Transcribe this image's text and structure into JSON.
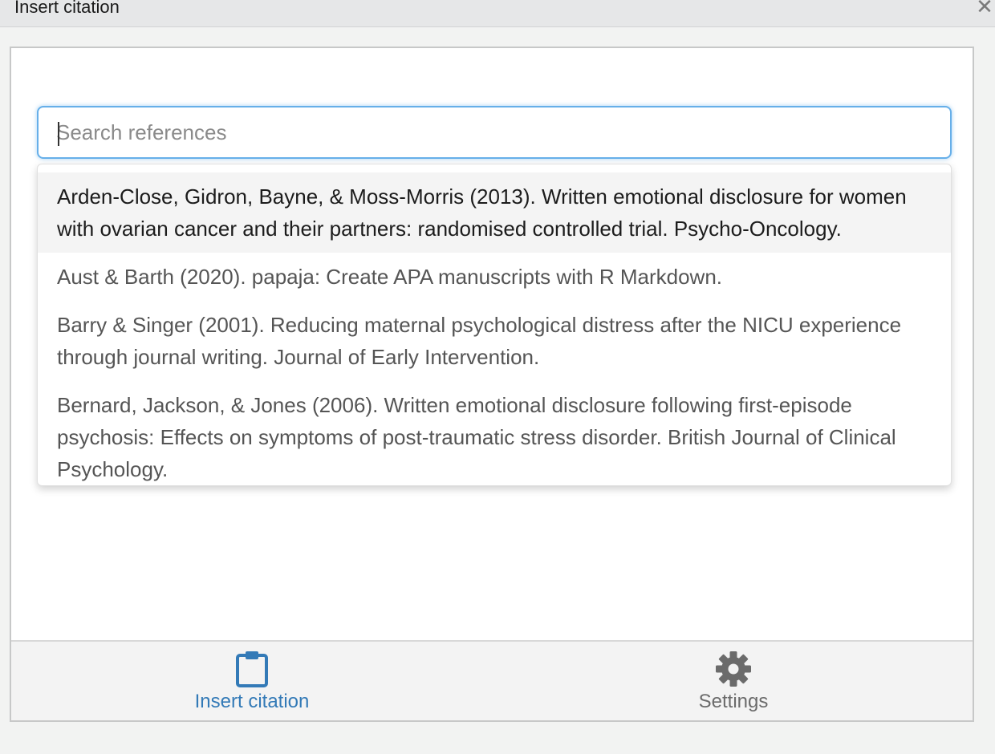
{
  "window": {
    "title": "Insert citation",
    "close_symbol": "✕"
  },
  "search": {
    "placeholder": "Search references",
    "value": ""
  },
  "references": [
    {
      "text": "Arden-Close, Gidron, Bayne, & Moss-Morris (2013). Written emotional disclosure for women with ovarian cancer and their partners: randomised controlled trial. Psycho-Oncology.",
      "highlighted": true
    },
    {
      "text": "Aust & Barth (2020). papaja: Create APA manuscripts with R Markdown.",
      "highlighted": false
    },
    {
      "text": "Barry & Singer (2001). Reducing maternal psychological distress after the NICU experience through journal writing. Journal of Early Intervention.",
      "highlighted": false
    },
    {
      "text": "Bernard, Jackson, & Jones (2006). Written emotional disclosure following first-episode psychosis: Effects on symptoms of post-traumatic stress disorder. British Journal of Clinical Psychology.",
      "highlighted": false
    }
  ],
  "footer": {
    "insert_label": "Insert citation",
    "insert_icon": "clipboard-icon",
    "settings_label": "Settings",
    "settings_icon": "gear-icon"
  },
  "colors": {
    "accent": "#337ab7",
    "focus_border": "#66afe9",
    "inactive_tab": "#6b6b6b"
  }
}
